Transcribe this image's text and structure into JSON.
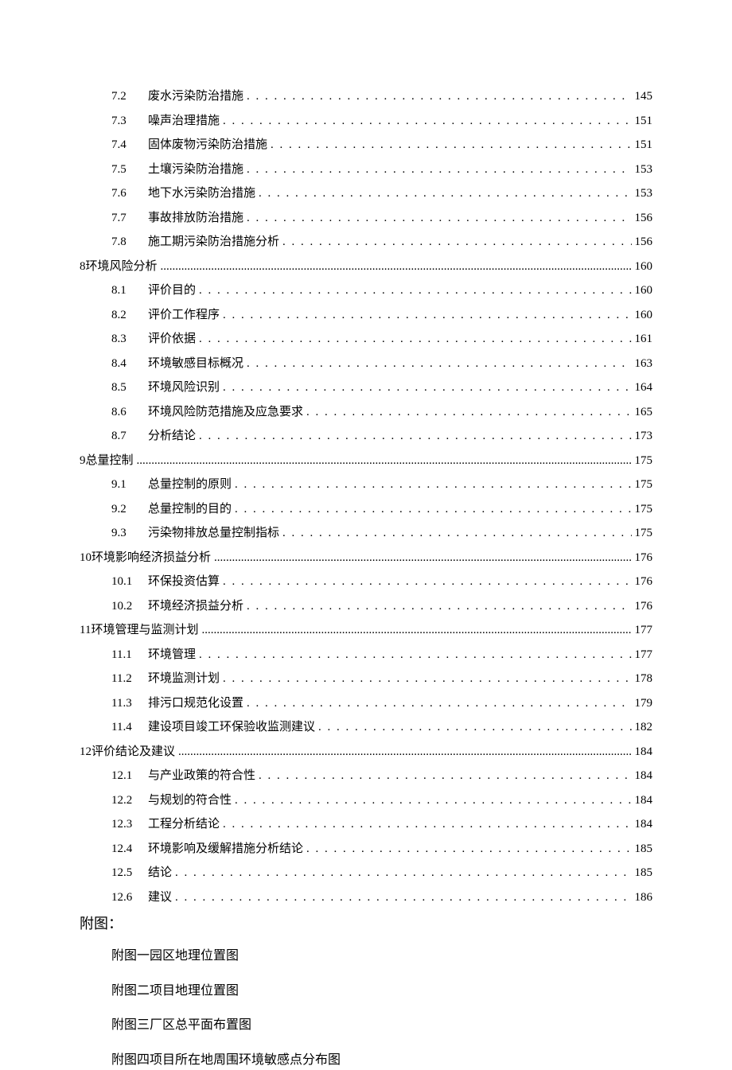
{
  "toc": [
    {
      "level": 2,
      "num": "7.2",
      "title": "废水污染防治措施",
      "page": "145",
      "leader": "dotted"
    },
    {
      "level": 2,
      "num": "7.3",
      "title": "噪声治理措施",
      "page": "151",
      "leader": "dotted"
    },
    {
      "level": 2,
      "num": "7.4",
      "title": "固体废物污染防治措施",
      "page": "151",
      "leader": "dotted"
    },
    {
      "level": 2,
      "num": "7.5",
      "title": "土壤污染防治措施",
      "page": "153",
      "leader": "dotted"
    },
    {
      "level": 2,
      "num": "7.6",
      "title": "地下水污染防治措施",
      "page": "153",
      "leader": "dotted"
    },
    {
      "level": 2,
      "num": "7.7",
      "title": "事故排放防治措施",
      "page": "156",
      "leader": "dotted"
    },
    {
      "level": 2,
      "num": "7.8",
      "title": "施工期污染防治措施分析",
      "page": "156",
      "leader": "dotted"
    },
    {
      "level": 1,
      "num": "8",
      "title": "环境风险分析",
      "page": "160",
      "leader": "dense"
    },
    {
      "level": 2,
      "num": "8.1",
      "title": "评价目的",
      "page": "160",
      "leader": "dotted"
    },
    {
      "level": 2,
      "num": "8.2",
      "title": "评价工作程序",
      "page": "160",
      "leader": "dotted"
    },
    {
      "level": 2,
      "num": "8.3",
      "title": "评价依据",
      "page": "161",
      "leader": "dotted"
    },
    {
      "level": 2,
      "num": "8.4",
      "title": "环境敏感目标概况",
      "page": "163",
      "leader": "dotted"
    },
    {
      "level": 2,
      "num": "8.5",
      "title": "环境风险识别",
      "page": "164",
      "leader": "dotted"
    },
    {
      "level": 2,
      "num": "8.6",
      "title": "环境风险防范措施及应急要求",
      "page": "165",
      "leader": "dotted"
    },
    {
      "level": 2,
      "num": "8.7",
      "title": "分析结论",
      "page": "173",
      "leader": "dotted"
    },
    {
      "level": 1,
      "num": "9",
      "title": "总量控制",
      "page": "175",
      "leader": "dense"
    },
    {
      "level": 2,
      "num": "9.1",
      "title": "总量控制的原则",
      "page": "175",
      "leader": "dotted"
    },
    {
      "level": 2,
      "num": "9.2",
      "title": "总量控制的目的",
      "page": "175",
      "leader": "dotted"
    },
    {
      "level": 2,
      "num": "9.3",
      "title": "污染物排放总量控制指标",
      "page": "175",
      "leader": "dotted"
    },
    {
      "level": 1,
      "num": "10",
      "title": "环境影响经济损益分析",
      "page": "176",
      "leader": "dense"
    },
    {
      "level": 2,
      "num": "10.1",
      "title": "环保投资估算",
      "page": "176",
      "leader": "dotted"
    },
    {
      "level": 2,
      "num": "10.2",
      "title": "环境经济损益分析",
      "page": "176",
      "leader": "dotted"
    },
    {
      "level": 1,
      "num": "11",
      "title": "环境管理与监测计划",
      "page": "177",
      "leader": "dense"
    },
    {
      "level": 2,
      "num": "11.1",
      "title": "环境管理",
      "page": "177",
      "leader": "dotted"
    },
    {
      "level": 2,
      "num": "11.2",
      "title": "环境监测计划",
      "page": "178",
      "leader": "dotted"
    },
    {
      "level": 2,
      "num": "11.3",
      "title": "排污口规范化设置",
      "page": "179",
      "leader": "dotted"
    },
    {
      "level": 2,
      "num": "11.4",
      "title": "建设项目竣工环保验收监测建议",
      "page": "182",
      "leader": "dotted"
    },
    {
      "level": 1,
      "num": "12",
      "title": "评价结论及建议",
      "page": "184",
      "leader": "dense"
    },
    {
      "level": 2,
      "num": "12.1",
      "title": "与产业政策的符合性",
      "page": "184",
      "leader": "dotted"
    },
    {
      "level": 2,
      "num": "12.2",
      "title": "与规划的符合性",
      "page": "184",
      "leader": "dotted"
    },
    {
      "level": 2,
      "num": "12.3",
      "title": "工程分析结论",
      "page": "184",
      "leader": "dotted"
    },
    {
      "level": 2,
      "num": "12.4",
      "title": "环境影响及缓解措施分析结论",
      "page": "185",
      "leader": "dotted"
    },
    {
      "level": 2,
      "num": "12.5",
      "title": "结论",
      "page": "185",
      "leader": "dotted"
    },
    {
      "level": 2,
      "num": "12.6",
      "title": "建议",
      "page": "186",
      "leader": "dotted"
    }
  ],
  "appendix": {
    "heading": "附图：",
    "items": [
      "附图一园区地理位置图",
      "附图二项目地理位置图",
      "附图三厂区总平面布置图",
      "附图四项目所在地周围环境敏感点分布图"
    ]
  }
}
